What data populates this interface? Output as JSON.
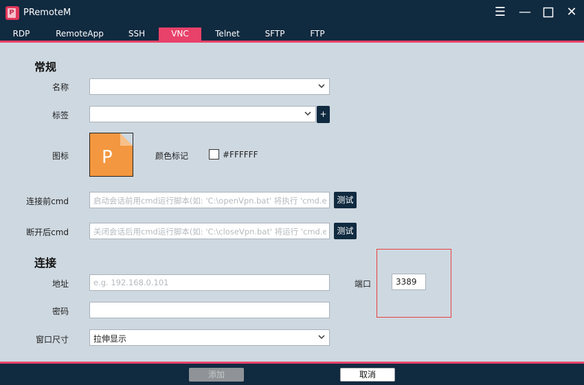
{
  "window": {
    "logo_letter": "P",
    "title": "PRemoteM",
    "menu_glyph": "☰",
    "minimize_glyph": "—",
    "close_glyph": "✕"
  },
  "tabs": [
    {
      "label": "RDP",
      "active": false
    },
    {
      "label": "RemoteApp",
      "active": false
    },
    {
      "label": "SSH",
      "active": false
    },
    {
      "label": "VNC",
      "active": true
    },
    {
      "label": "Telnet",
      "active": false
    },
    {
      "label": "SFTP",
      "active": false
    },
    {
      "label": "FTP",
      "active": false
    }
  ],
  "general": {
    "section_title": "常规",
    "name_label": "名称",
    "name_value": "",
    "tag_label": "标签",
    "tag_value": "",
    "add_tag_button": "+",
    "icon_label": "图标",
    "icon_letter": "P",
    "color_label": "颜色标记",
    "color_value": "#FFFFFF",
    "pre_cmd_label": "连接前cmd",
    "pre_cmd_placeholder": "启动会话前用cmd运行脚本(如: 'C:\\openVpn.bat' 将执行 'cmd.exe /c C:\\openVpn.bat')",
    "post_cmd_label": "断开后cmd",
    "post_cmd_placeholder": "关闭会话后用cmd运行脚本(如: 'C:\\closeVpn.bat' 将运行 'cmd.exe /c C:\\closeVpn.bat')",
    "test_button": "测试"
  },
  "connection": {
    "section_title": "连接",
    "address_label": "地址",
    "address_placeholder": "e.g. 192.168.0.101",
    "port_label": "端口",
    "port_value": "3389",
    "password_label": "密码",
    "password_value": "",
    "window_size_label": "窗口尺寸",
    "window_size_value": "拉伸显示"
  },
  "footer": {
    "add_button": "添加",
    "cancel_button": "取消"
  },
  "colors": {
    "titlebar": "#102a40",
    "accent": "#e8416a",
    "background": "#ced8e0",
    "icon_orange": "#f39740",
    "highlight": "#e84040"
  }
}
